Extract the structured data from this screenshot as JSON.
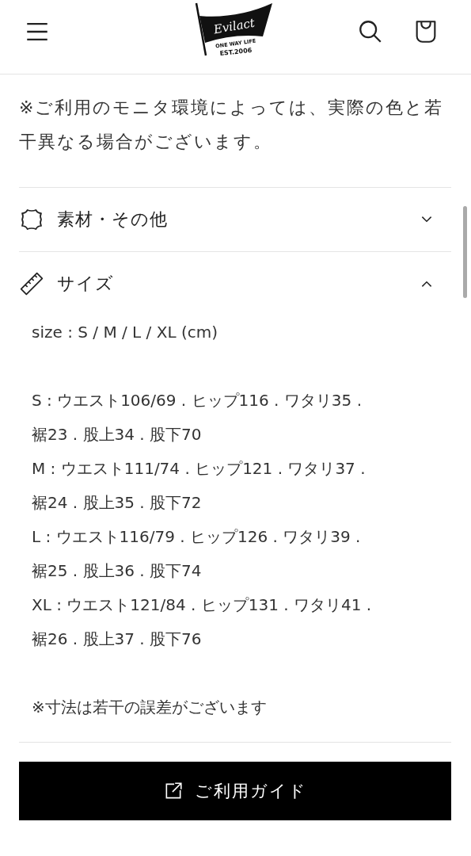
{
  "header": {
    "logo": {
      "name": "Evilact",
      "tagline": "ONE WAY LIFE",
      "est": "EST.2006"
    }
  },
  "notes": [
    "※ご利用のモニタ環境によっては、実際の色と若干異なる場合がございます。"
  ],
  "accordions": [
    {
      "kind": "material",
      "title": "素材・その他",
      "expanded": false
    },
    {
      "kind": "size",
      "title": "サイズ",
      "expanded": true,
      "content": [
        [
          "size : S / M / L / XL (cm)"
        ],
        [
          "S : ウエスト106/69 . ヒップ116 . ワタリ35 .",
          "裾23 . 股上34 . 股下70",
          "M : ウエスト111/74 . ヒップ121 . ワタリ37 .",
          "裾24 . 股上35 . 股下72",
          "L : ウエスト116/79 . ヒップ126 . ワタリ39 .",
          "裾25 . 股上36 . 股下74",
          "XL : ウエスト121/84 . ヒップ131 . ワタリ41 .",
          "裾26 . 股上37 . 股下76"
        ],
        [
          "※寸法は若干の誤差がございます"
        ]
      ]
    }
  ],
  "guide_button": {
    "label": "ご利用ガイド"
  }
}
